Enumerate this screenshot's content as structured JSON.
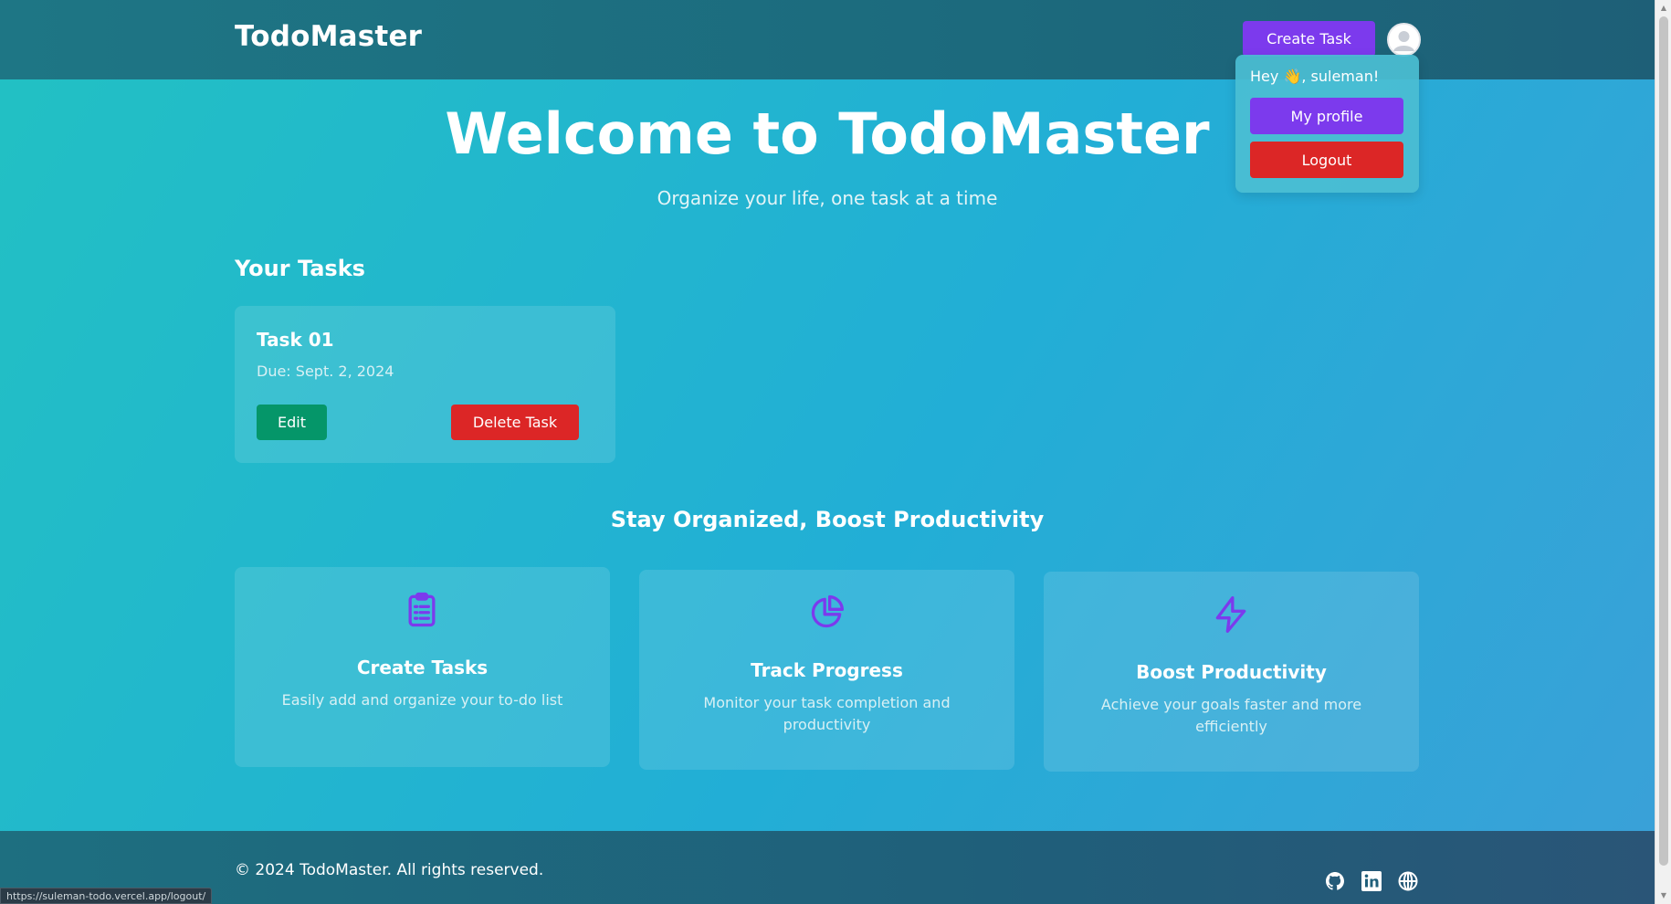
{
  "header": {
    "brand": "TodoMaster",
    "create_task_label": "Create Task"
  },
  "user_menu": {
    "greeting_prefix": "Hey",
    "greeting_emoji": "👋",
    "greeting_suffix": ", suleman!",
    "profile_label": "My profile",
    "logout_label": "Logout"
  },
  "hero": {
    "title": "Welcome to TodoMaster",
    "subtitle": "Organize your life, one task at a time"
  },
  "tasks_section": {
    "title": "Your Tasks",
    "tasks": [
      {
        "title": "Task 01",
        "due": "Due: Sept. 2, 2024",
        "edit_label": "Edit",
        "delete_label": "Delete Task"
      }
    ]
  },
  "features_section": {
    "title": "Stay Organized, Boost Productivity",
    "features": [
      {
        "icon": "clipboard-list-icon",
        "name": "Create Tasks",
        "description": "Easily add and organize your to-do list"
      },
      {
        "icon": "pie-chart-icon",
        "name": "Track Progress",
        "description": "Monitor your task completion and productivity"
      },
      {
        "icon": "lightning-bolt-icon",
        "name": "Boost Productivity",
        "description": "Achieve your goals faster and more efficiently"
      }
    ]
  },
  "footer": {
    "copyright": "© 2024 TodoMaster. All rights reserved.",
    "social": [
      "github-icon",
      "linkedin-icon",
      "globe-icon"
    ]
  },
  "status_bar": {
    "url": "https://suleman-todo.vercel.app/logout/"
  },
  "colors": {
    "accent_purple": "#7c3aed",
    "danger_red": "#dc2626",
    "success_green": "#059669"
  }
}
